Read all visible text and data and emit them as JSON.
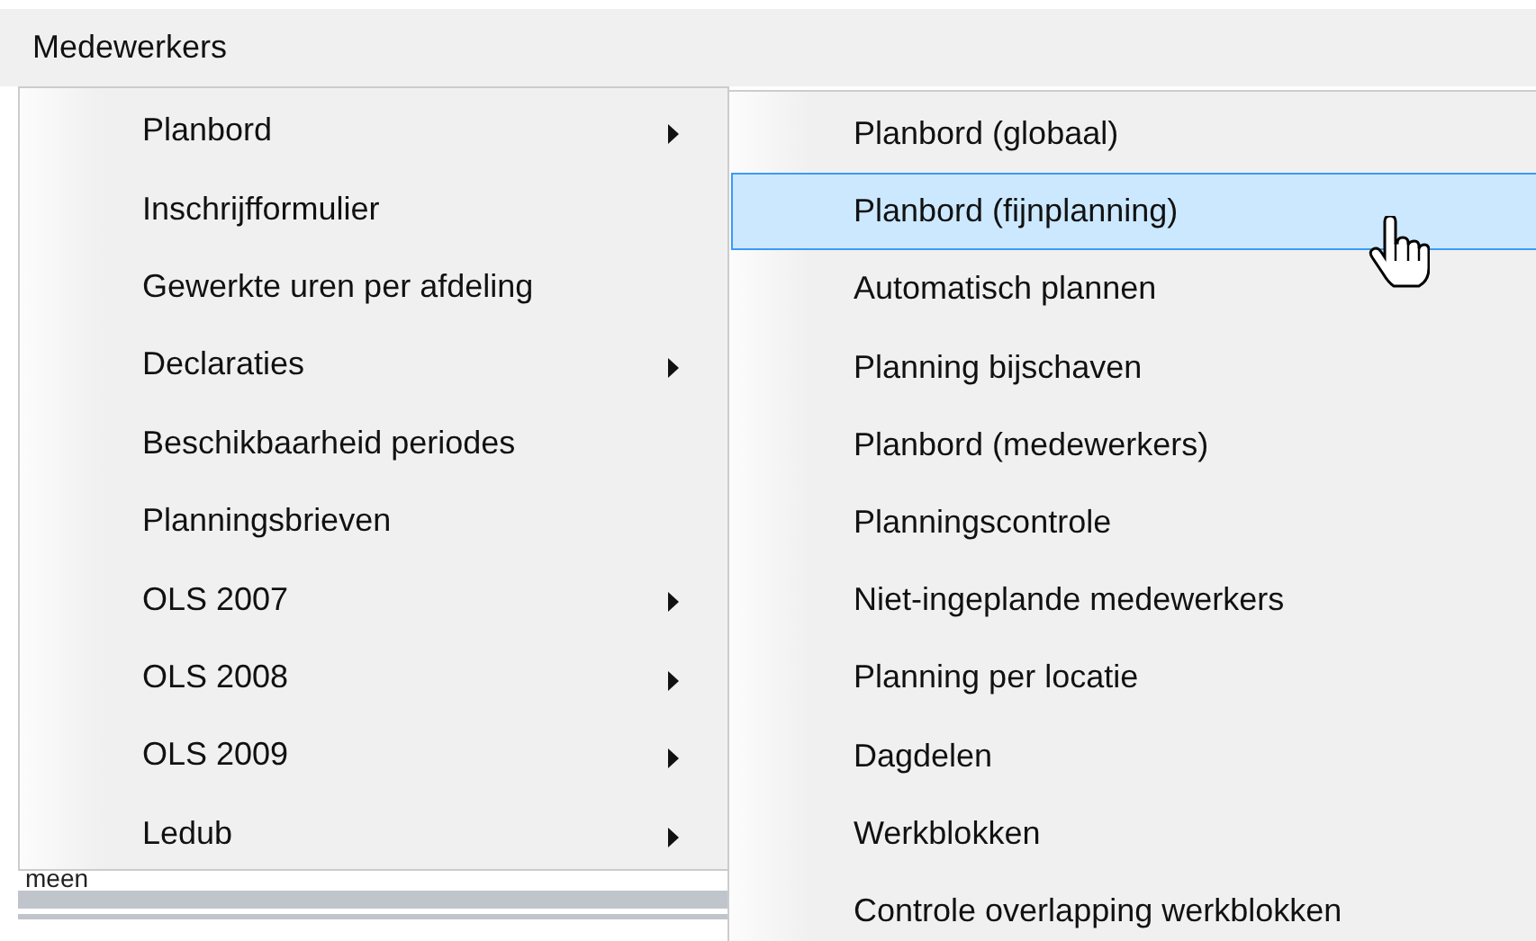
{
  "menu_bar": {
    "items": [
      {
        "label": "Medewerkers",
        "selected": false
      }
    ]
  },
  "background": {
    "text": "meen"
  },
  "menu": {
    "items": [
      {
        "label": "Planbord",
        "has_submenu": true
      },
      {
        "label": "Inschrijfformulier",
        "has_submenu": false
      },
      {
        "label": "Gewerkte uren per afdeling",
        "has_submenu": false
      },
      {
        "label": "Declaraties",
        "has_submenu": true
      },
      {
        "label": "Beschikbaarheid periodes",
        "has_submenu": false
      },
      {
        "label": "Planningsbrieven",
        "has_submenu": false
      },
      {
        "label": "OLS 2007",
        "has_submenu": true
      },
      {
        "label": "OLS 2008",
        "has_submenu": true
      },
      {
        "label": "OLS 2009",
        "has_submenu": true
      },
      {
        "label": "Ledub",
        "has_submenu": true
      }
    ]
  },
  "submenu": {
    "items": [
      {
        "label": "Planbord (globaal)",
        "selected": false
      },
      {
        "label": "Planbord (fijnplanning)",
        "selected": true
      },
      {
        "label": "Automatisch plannen",
        "selected": false
      },
      {
        "label": "Planning bijschaven",
        "selected": false
      },
      {
        "label": "Planbord (medewerkers)",
        "selected": false
      },
      {
        "label": "Planningscontrole",
        "selected": false
      },
      {
        "label": "Niet-ingeplande medewerkers",
        "selected": false
      },
      {
        "label": "Planning per locatie",
        "selected": false
      },
      {
        "label": "Dagdelen",
        "selected": false
      },
      {
        "label": "Werkblokken",
        "selected": false
      },
      {
        "label": "Controle overlapping werkblokken",
        "selected": false
      }
    ]
  }
}
